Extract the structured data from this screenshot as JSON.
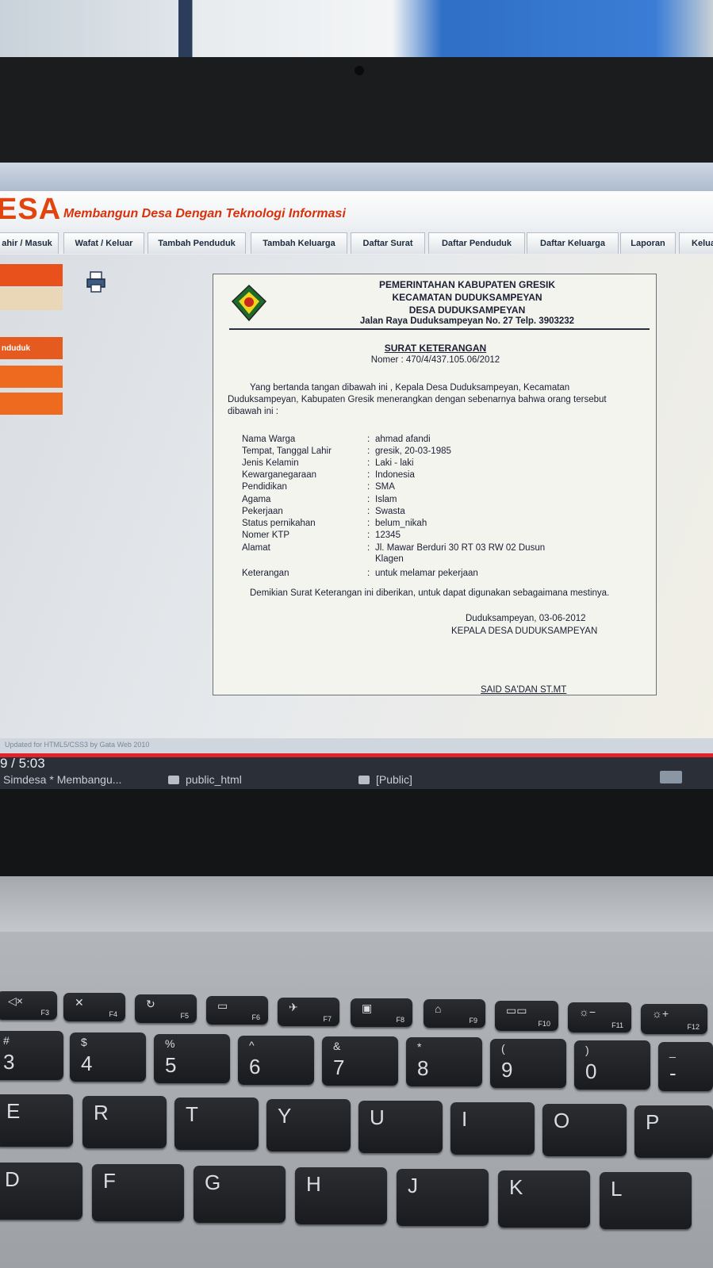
{
  "site": {
    "brand": "ESA",
    "tagline": "Membangun Desa Dengan Teknologi Informasi"
  },
  "nav": [
    "ahir / Masuk",
    "Wafat / Keluar",
    "Tambah Penduduk",
    "Tambah Keluarga",
    "Daftar Surat",
    "Daftar Penduduk",
    "Daftar Keluarga",
    "Laporan",
    "Kelua"
  ],
  "sidebar": {
    "item_penduduk": "nduduk"
  },
  "letter": {
    "header": [
      "PEMERINTAHAN KABUPATEN GRESIK",
      "KECAMATAN DUDUKSAMPEYAN",
      "DESA DUDUKSAMPEYAN",
      "Jalan Raya Duduksampeyan No. 27 Telp. 3903232"
    ],
    "title": "SURAT KETERANGAN",
    "nomer": "Nomer : 470/4/437.105.06/2012",
    "intro": "Yang bertanda tangan dibawah ini , Kepala Desa Duduksampeyan, Kecamatan Duduksampeyan, Kabupaten Gresik menerangkan dengan sebenarnya bahwa orang tersebut dibawah ini :",
    "fields": [
      {
        "label": "Nama Warga",
        "value": "ahmad afandi"
      },
      {
        "label": "Tempat, Tanggal Lahir",
        "value": "gresik, 20-03-1985"
      },
      {
        "label": "Jenis Kelamin",
        "value": "Laki - laki"
      },
      {
        "label": "Kewarganegaraan",
        "value": "Indonesia"
      },
      {
        "label": "Pendidikan",
        "value": "SMA"
      },
      {
        "label": "Agama",
        "value": "Islam"
      },
      {
        "label": "Pekerjaan",
        "value": "Swasta"
      },
      {
        "label": "Status pernikahan",
        "value": "belum_nikah"
      },
      {
        "label": "Nomer KTP",
        "value": "12345"
      },
      {
        "label": "Alamat",
        "value": "Jl. Mawar Berduri 30 RT 03 RW 02 Dusun Klagen"
      },
      {
        "label": "Keterangan",
        "value": "untuk melamar pekerjaan"
      }
    ],
    "colon": ":",
    "closing": "Demikian Surat Keterangan ini diberikan, untuk dapat digunakan sebagaimana mestinya.",
    "place_date": "Duduksampeyan, 03-06-2012",
    "signer_role": "KEPALA DESA DUDUKSAMPEYAN",
    "signer_name": "SAID SA'DAN ST.MT"
  },
  "footer": "Updated for HTML5/CSS3 by Gata Web 2010",
  "player": {
    "time": "9 / 5:03"
  },
  "taskbar": [
    {
      "label": "Simdesa * Membangu..."
    },
    {
      "label": "public_html"
    },
    {
      "label": "[Public]"
    }
  ],
  "keyboard": {
    "fn_row": [
      {
        "icon": "mic-mute",
        "label": "F3"
      },
      {
        "icon": "x",
        "label": "F4"
      },
      {
        "icon": "refresh",
        "label": "F5"
      },
      {
        "icon": "touchpad-off",
        "label": "F6"
      },
      {
        "icon": "airplane",
        "label": "F7"
      },
      {
        "icon": "camera-off",
        "label": "F8"
      },
      {
        "icon": "lock",
        "label": "F9"
      },
      {
        "icon": "display",
        "label": "F10"
      },
      {
        "icon": "brightness-down",
        "label": "F11"
      },
      {
        "icon": "brightness-up",
        "label": "F12"
      }
    ],
    "num_row": [
      {
        "top": "#",
        "main": "3"
      },
      {
        "top": "$",
        "main": "4"
      },
      {
        "top": "%",
        "main": "5"
      },
      {
        "top": "^",
        "main": "6"
      },
      {
        "top": "&",
        "main": "7"
      },
      {
        "top": "*",
        "main": "8"
      },
      {
        "top": "(",
        "main": "9"
      },
      {
        "top": ")",
        "main": "0"
      },
      {
        "top": "_",
        "main": "-"
      }
    ],
    "qwerty_row": [
      "E",
      "R",
      "T",
      "Y",
      "U",
      "I",
      "O",
      "P"
    ],
    "home_row": [
      "D",
      "F",
      "G",
      "H",
      "J",
      "K",
      "L"
    ]
  }
}
